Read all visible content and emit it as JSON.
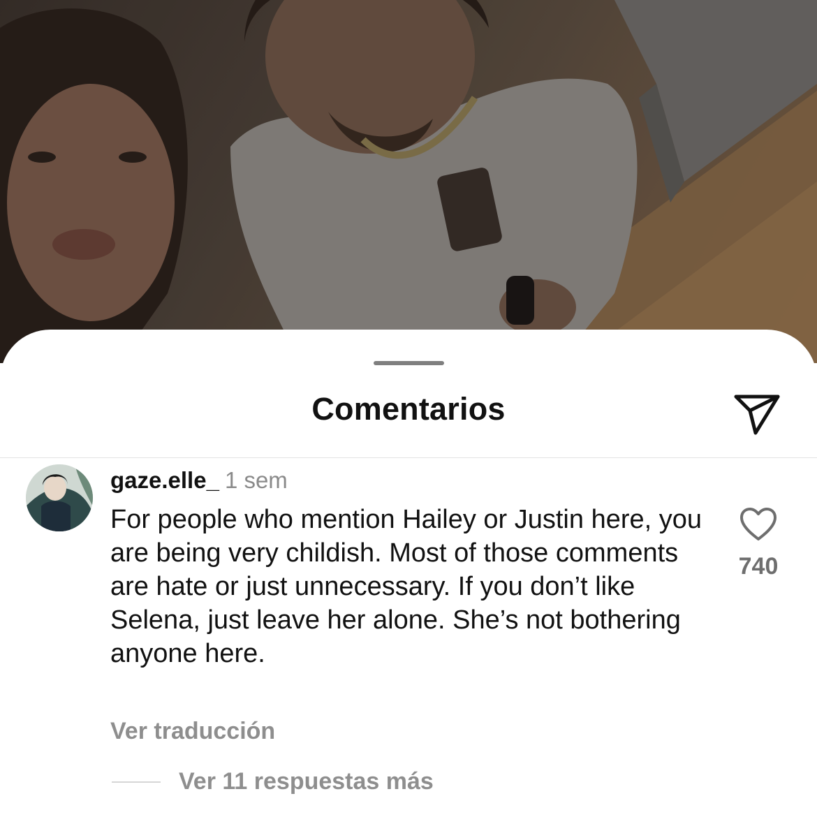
{
  "sheet": {
    "title": "Comentarios",
    "share_icon": "paper-plane-icon"
  },
  "comment": {
    "username": "gaze.elle_",
    "timestamp": "1 sem",
    "text": "For people who mention Hailey or Justin here, you are being very childish. Most of those comments are hate or just unnecessary. If you don’t like Selena, just leave her alone. She’s not bothering anyone here.",
    "like_icon": "heart-icon",
    "like_count": "740",
    "translate_label": "Ver traducción",
    "replies_label": "Ver 11 respuestas más"
  },
  "colors": {
    "title": "#111111",
    "secondary_text": "#8e8e8e",
    "divider": "#e3e3e3",
    "sheet_background": "#ffffff"
  }
}
